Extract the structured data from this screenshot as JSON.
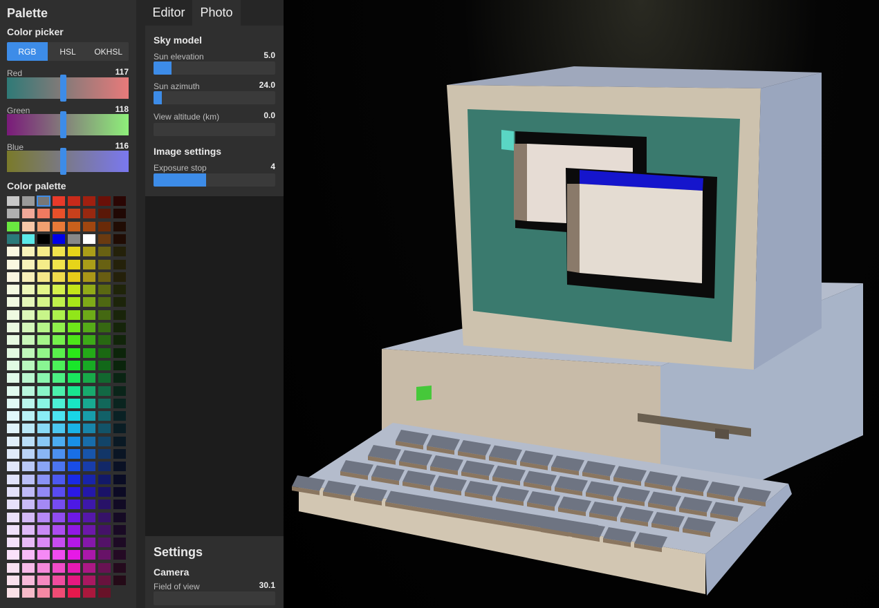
{
  "palette": {
    "title": "Palette",
    "picker_title": "Color picker",
    "modes": [
      "RGB",
      "HSL",
      "OKHSL"
    ],
    "active_mode": "RGB",
    "channels": [
      {
        "label": "Red",
        "value": 117,
        "fraction": 0.46,
        "from": "#2f7a77",
        "to": "#e87a7a"
      },
      {
        "label": "Green",
        "value": 118,
        "fraction": 0.46,
        "from": "#7a1a7a",
        "to": "#8ef07a"
      },
      {
        "label": "Blue",
        "value": 116,
        "fraction": 0.46,
        "from": "#7a7a2a",
        "to": "#7a78f0"
      }
    ],
    "palette_title": "Color palette",
    "selected_swatch": "#777777"
  },
  "tabs": {
    "editor": "Editor",
    "photo": "Photo",
    "active": "Photo"
  },
  "sky": {
    "title": "Sky model",
    "sliders": [
      {
        "label": "Sun elevation",
        "value": "5.0",
        "fraction": 0.15
      },
      {
        "label": "Sun azimuth",
        "value": "24.0",
        "fraction": 0.07
      },
      {
        "label": "View altitude (km)",
        "value": "0.0",
        "fraction": 0.0
      }
    ]
  },
  "image": {
    "title": "Image settings",
    "sliders": [
      {
        "label": "Exposure stop",
        "value": "4",
        "fraction": 0.43
      }
    ]
  },
  "settings": {
    "title": "Settings",
    "camera_title": "Camera",
    "sliders": [
      {
        "label": "Field of view",
        "value": "30.1",
        "fraction": 0.0
      }
    ]
  },
  "colors": {
    "accent": "#3d8ce8",
    "panel": "#2f2f2f",
    "track": "#3a3a3a"
  }
}
